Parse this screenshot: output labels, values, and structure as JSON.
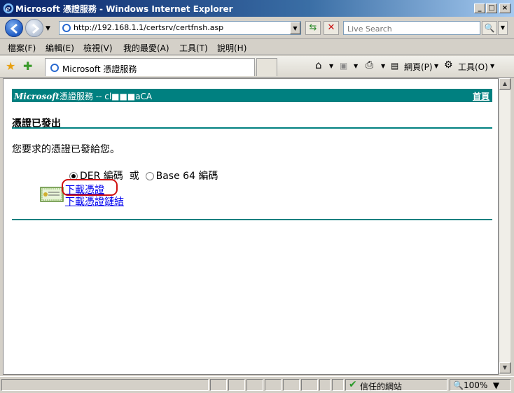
{
  "window": {
    "title": "Microsoft 憑證服務 - Windows Internet Explorer",
    "min": "_",
    "max": "□",
    "close": "×"
  },
  "address": {
    "url": "http://192.168.1.1/certsrv/certfnsh.asp",
    "search_placeholder": "Live Search"
  },
  "menu": {
    "items": [
      "檔案(F)",
      "編輯(E)",
      "檢視(V)",
      "我的最愛(A)",
      "工具(T)",
      "說明(H)"
    ]
  },
  "tabs": {
    "active_label": "Microsoft 憑證服務"
  },
  "toolbar": {
    "page_label": "網頁(P)",
    "tools_label": "工具(O)"
  },
  "page": {
    "brand_italic": "Microsoft",
    "brand_rest": "憑證服務  --  cl■■■aCA",
    "home_link": "首頁",
    "title": "憑證已發出",
    "message": "您要求的憑證已發給您。",
    "encoding": {
      "der_label": "DER 編碼",
      "or_label": "或",
      "base64_label": "Base 64 編碼",
      "selected": "DER"
    },
    "download_cert": "下載憑證",
    "download_chain": "下載憑證鏈結"
  },
  "status": {
    "zone": "信任的網站",
    "zoom": "100%"
  },
  "colors": {
    "teal": "#008080",
    "link": "#0000ee",
    "highlight": "#d01010"
  }
}
